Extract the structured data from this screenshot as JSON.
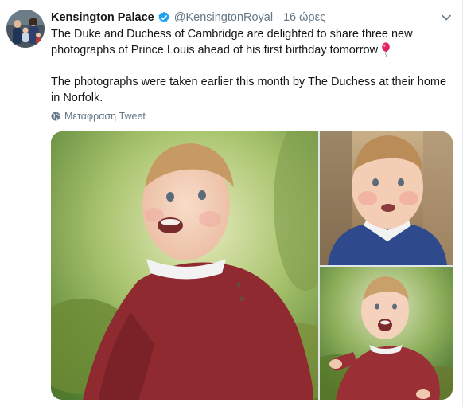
{
  "tweet": {
    "author_name": "Kensington Palace",
    "handle": "@KensingtonRoyal",
    "separator": "·",
    "time": "16 ώρες",
    "paragraph_1": "The Duke and Duchess of Cambridge are delighted to share three new photographs of Prince Louis ahead of his first birthday tomorrow",
    "paragraph_2": "The photographs were taken earlier this month by The Duchess at their home in Norfolk.",
    "translate_label": "Μετάφραση Tweet"
  },
  "icons": {
    "verified": "verified-badge-icon",
    "caret": "chevron-down-icon",
    "balloon": "balloon-emoji-icon",
    "globe": "globe-icon"
  },
  "colors": {
    "verified_blue": "#1da1f2",
    "secondary_text": "#657786",
    "primary_text": "#14171a",
    "balloon_red": "#e0245e"
  }
}
